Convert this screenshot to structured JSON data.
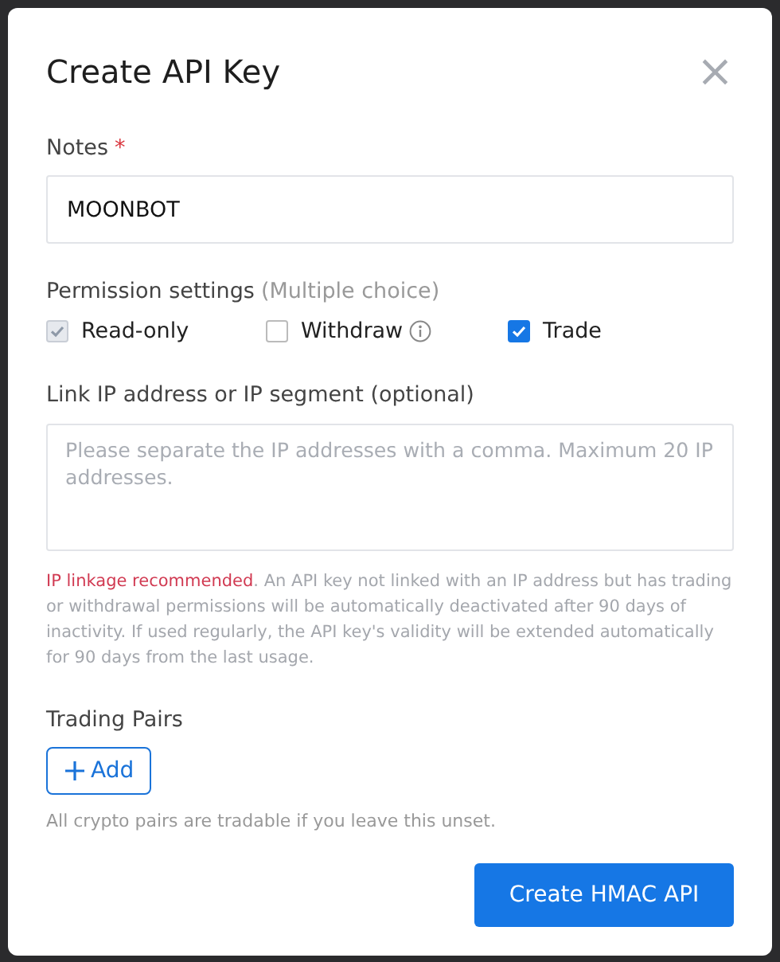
{
  "dialog": {
    "title": "Create API Key",
    "close": "×"
  },
  "notes": {
    "label": "Notes",
    "required_mark": "*",
    "value": "MOONBOT"
  },
  "permissions": {
    "label": "Permission settings",
    "hint": "(Multiple choice)",
    "options": [
      {
        "label": "Read-only",
        "checked": true,
        "disabled": true,
        "info": false
      },
      {
        "label": "Withdraw",
        "checked": false,
        "disabled": false,
        "info": true
      },
      {
        "label": "Trade",
        "checked": true,
        "disabled": false,
        "info": false
      }
    ]
  },
  "ip": {
    "label": "Link IP address or IP segment (optional)",
    "placeholder": "Please separate the IP addresses with a comma. Maximum 20 IP addresses.",
    "warning_highlight": "IP linkage recommended",
    "warning_text": ". An API key not linked with an IP address but has trading or withdrawal permissions will be automatically deactivated after 90 days of inactivity. If used regularly, the API key's validity will be extended automatically for 90 days from the last usage."
  },
  "trading_pairs": {
    "label": "Trading Pairs",
    "add_button": "Add",
    "hint": "All crypto pairs are tradable if you leave this unset."
  },
  "submit_button": "Create HMAC API"
}
